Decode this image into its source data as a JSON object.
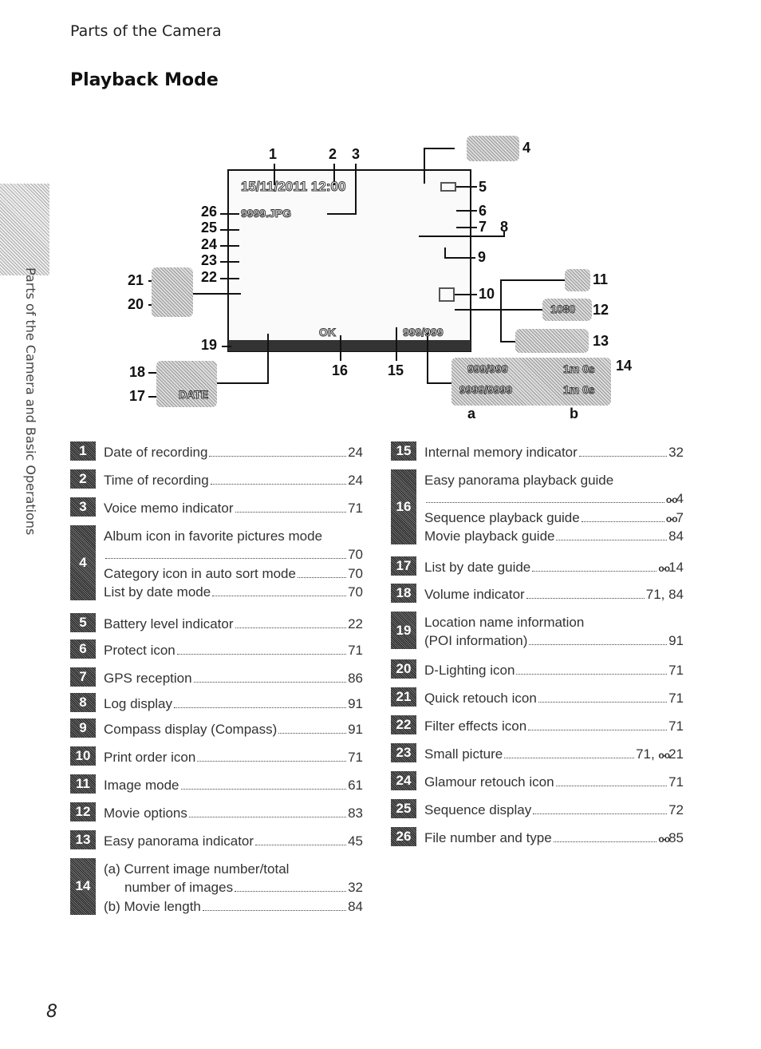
{
  "header": "Parts of the Camera",
  "title": "Playback Mode",
  "side_tab": "Parts of the Camera and Basic Operations",
  "page_number": "8",
  "ref_icon": "binoculars-reference-icon",
  "diagram": {
    "callouts": [
      "1",
      "2",
      "3",
      "4",
      "5",
      "6",
      "7",
      "8",
      "9",
      "10",
      "11",
      "12",
      "13",
      "14",
      "15",
      "16",
      "17",
      "18",
      "19",
      "20",
      "21",
      "22",
      "23",
      "24",
      "25",
      "26",
      "a",
      "b"
    ],
    "screen": {
      "datetime": "15/11/2011  12:00",
      "file": "9999.JPG",
      "counter": "999/999",
      "ok": "OK"
    },
    "variants": {
      "a1": "999/999",
      "b1": "1m 0s",
      "a2": "9999/9999",
      "b2": "1m 0s",
      "resolution": "1080",
      "date_guide": "DATE"
    }
  },
  "left_items": [
    {
      "n": "1",
      "lines": [
        {
          "t": "Date of recording",
          "p": "24"
        }
      ]
    },
    {
      "n": "2",
      "lines": [
        {
          "t": "Time of recording",
          "p": "24"
        }
      ]
    },
    {
      "n": "3",
      "lines": [
        {
          "t": "Voice memo indicator",
          "p": "71"
        }
      ]
    },
    {
      "n": "4",
      "lines": [
        {
          "t": "Album icon in favorite pictures mode",
          "p": ""
        },
        {
          "t": "",
          "p": "70"
        },
        {
          "t": "Category icon in auto sort mode",
          "p": "70"
        },
        {
          "t": "List by date mode",
          "p": "70"
        }
      ]
    },
    {
      "n": "5",
      "lines": [
        {
          "t": "Battery level indicator",
          "p": "22"
        }
      ]
    },
    {
      "n": "6",
      "lines": [
        {
          "t": "Protect icon",
          "p": "71"
        }
      ]
    },
    {
      "n": "7",
      "lines": [
        {
          "t": "GPS reception",
          "p": "86"
        }
      ]
    },
    {
      "n": "8",
      "lines": [
        {
          "t": "Log display",
          "p": "91"
        }
      ]
    },
    {
      "n": "9",
      "lines": [
        {
          "t": "Compass display (Compass)",
          "p": "91"
        }
      ]
    },
    {
      "n": "10",
      "lines": [
        {
          "t": "Print order icon",
          "p": "71"
        }
      ]
    },
    {
      "n": "11",
      "lines": [
        {
          "t": "Image mode",
          "p": "61"
        }
      ]
    },
    {
      "n": "12",
      "lines": [
        {
          "t": "Movie options",
          "p": "83"
        }
      ]
    },
    {
      "n": "13",
      "lines": [
        {
          "t": "Easy panorama indicator",
          "p": "45"
        }
      ]
    },
    {
      "n": "14",
      "lines": [
        {
          "t": "(a) Current image number/total",
          "p": ""
        },
        {
          "t": "number of images",
          "p": "32",
          "ind": true
        },
        {
          "t": "(b) Movie length",
          "p": "84"
        }
      ]
    }
  ],
  "right_items": [
    {
      "n": "15",
      "lines": [
        {
          "t": "Internal memory indicator",
          "p": "32"
        }
      ]
    },
    {
      "n": "16",
      "lines": [
        {
          "t": "Easy panorama playback guide",
          "p": ""
        },
        {
          "t": "",
          "p": "4",
          "ref": true
        },
        {
          "t": "Sequence playback guide",
          "p": "7",
          "ref": true
        },
        {
          "t": "Movie playback guide",
          "p": "84"
        }
      ]
    },
    {
      "n": "17",
      "lines": [
        {
          "t": "List by date guide",
          "p": "14",
          "ref": true
        }
      ]
    },
    {
      "n": "18",
      "lines": [
        {
          "t": "Volume indicator",
          "p": "71, 84"
        }
      ]
    },
    {
      "n": "19",
      "lines": [
        {
          "t": "Location name information",
          "p": ""
        },
        {
          "t": "(POI information)",
          "p": "91"
        }
      ]
    },
    {
      "n": "20",
      "lines": [
        {
          "t": "D-Lighting icon",
          "p": "71"
        }
      ]
    },
    {
      "n": "21",
      "lines": [
        {
          "t": "Quick retouch icon",
          "p": "71"
        }
      ]
    },
    {
      "n": "22",
      "lines": [
        {
          "t": "Filter effects icon",
          "p": "71"
        }
      ]
    },
    {
      "n": "23",
      "lines": [
        {
          "t": "Small picture",
          "p": "71, ",
          "p2": "21",
          "ref": true
        }
      ]
    },
    {
      "n": "24",
      "lines": [
        {
          "t": "Glamour retouch icon",
          "p": "71"
        }
      ]
    },
    {
      "n": "25",
      "lines": [
        {
          "t": "Sequence display",
          "p": "72"
        }
      ]
    },
    {
      "n": "26",
      "lines": [
        {
          "t": "File number and type",
          "p": "85",
          "ref": true
        }
      ]
    }
  ]
}
